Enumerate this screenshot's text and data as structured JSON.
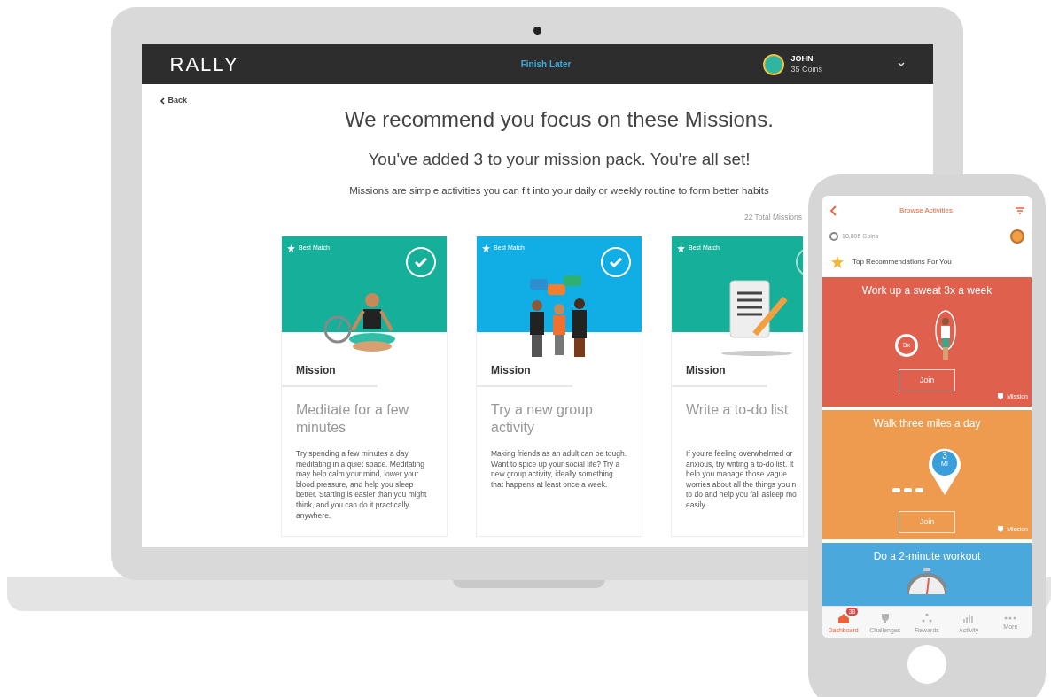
{
  "laptop": {
    "header": {
      "logo": "RALLY",
      "finish_later": "Finish Later",
      "user_name": "JOHN",
      "coins": "35 Coins"
    },
    "back": "Back",
    "headline": "We recommend you focus on these Missions.",
    "subheadline": "You've added 3 to your mission pack. You're all set!",
    "intro": "Missions are simple activities you can fit into your daily or weekly routine to form better habits",
    "total": "22 Total Missions",
    "cards": [
      {
        "kind": "meditate",
        "color": "#16b09a",
        "badge": "Best Match",
        "checked": true,
        "label": "Mission",
        "title": "Meditate for a few minutes",
        "lines": [
          "Try spending a few minutes a day meditating in a quiet space. Meditating may help calm your mind, lower your blood pressure, and help you sleep better. Starting is easier than you might think, and you can do it practically anywhere."
        ]
      },
      {
        "kind": "group",
        "color": "#10aee5",
        "badge": "Best Match",
        "checked": true,
        "label": "Mission",
        "title": "Try a new group activity",
        "lines": [
          "Making friends as an adult can be tough. Want to spice up your social life? Try a new group activity, ideally something that happens at least once a week."
        ]
      },
      {
        "kind": "notes",
        "color": "#16b09a",
        "badge": "Best Match",
        "label": "Mission",
        "title": "Write a to-do list",
        "lines": [
          "If you're feeling overwhelmed or",
          "anxious, try writing a to-do list. It",
          "help you manage those vague",
          "worries about all the things you n",
          "to do and help you fall asleep mo",
          "easily."
        ]
      }
    ]
  },
  "phone": {
    "title": "Browse Activities",
    "coins": "18,805 Coins",
    "section": "Top Recommendations For You",
    "activities": [
      {
        "kind": "rope",
        "color": "#e0604e",
        "title": "Work up a sweat 3x a week",
        "figure": "3x",
        "join": "Join",
        "tag": "Mission"
      },
      {
        "kind": "walk",
        "color": "#ee9a4f",
        "title": "Walk three miles a day",
        "figure": "3",
        "figure_unit": "MI",
        "join": "Join",
        "tag": "Mission"
      },
      {
        "kind": "timer",
        "color": "#4aa8dc",
        "title": "Do a 2-minute workout"
      }
    ],
    "tabs": [
      {
        "label": "Dashboard",
        "selected": true,
        "badge": "38"
      },
      {
        "label": "Challenges",
        "selected": false
      },
      {
        "label": "Rewards",
        "selected": false
      },
      {
        "label": "Activity",
        "selected": false
      },
      {
        "label": "More",
        "selected": false
      }
    ]
  }
}
